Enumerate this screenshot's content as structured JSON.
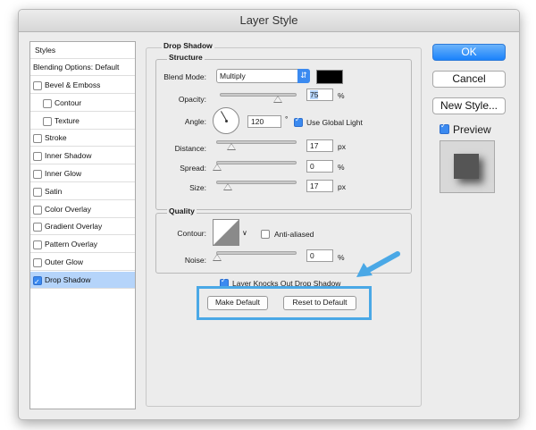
{
  "window": {
    "title": "Layer Style"
  },
  "styles_panel": {
    "header": "Styles",
    "blending": "Blending Options: Default",
    "items": [
      {
        "label": "Bevel & Emboss",
        "checked": false
      },
      {
        "label": "Contour",
        "checked": false
      },
      {
        "label": "Texture",
        "checked": false
      },
      {
        "label": "Stroke",
        "checked": false
      },
      {
        "label": "Inner Shadow",
        "checked": false
      },
      {
        "label": "Inner Glow",
        "checked": false
      },
      {
        "label": "Satin",
        "checked": false
      },
      {
        "label": "Color Overlay",
        "checked": false
      },
      {
        "label": "Gradient Overlay",
        "checked": false
      },
      {
        "label": "Pattern Overlay",
        "checked": false
      },
      {
        "label": "Outer Glow",
        "checked": false
      },
      {
        "label": "Drop Shadow",
        "checked": true
      }
    ]
  },
  "drop_shadow": {
    "title": "Drop Shadow",
    "structure": {
      "title": "Structure",
      "blend_mode_label": "Blend Mode:",
      "blend_mode_value": "Multiply",
      "blend_color": "#000000",
      "opacity_label": "Opacity:",
      "opacity_value": "75",
      "opacity_unit": "%",
      "opacity_level": 0.75,
      "angle_label": "Angle:",
      "angle_value": "120",
      "angle_unit": "°",
      "global_light_label": "Use Global Light",
      "global_light_checked": true,
      "distance_label": "Distance:",
      "distance_value": "17",
      "distance_unit": "px",
      "spread_label": "Spread:",
      "spread_value": "0",
      "spread_unit": "%",
      "size_label": "Size:",
      "size_value": "17",
      "size_unit": "px"
    },
    "quality": {
      "title": "Quality",
      "contour_label": "Contour:",
      "anti_aliased_label": "Anti-aliased",
      "anti_aliased_checked": false,
      "noise_label": "Noise:",
      "noise_value": "0",
      "noise_unit": "%"
    },
    "knockout_label": "Layer Knocks Out Drop Shadow",
    "knockout_checked": true,
    "make_default_label": "Make Default",
    "reset_default_label": "Reset to Default"
  },
  "buttons": {
    "ok": "OK",
    "cancel": "Cancel",
    "new_style": "New Style...",
    "preview": "Preview",
    "preview_checked": true
  },
  "colors": {
    "accent": "#1a82fb",
    "selection": "#b5d4fa",
    "highlight_annotation": "#4aa8e6"
  }
}
